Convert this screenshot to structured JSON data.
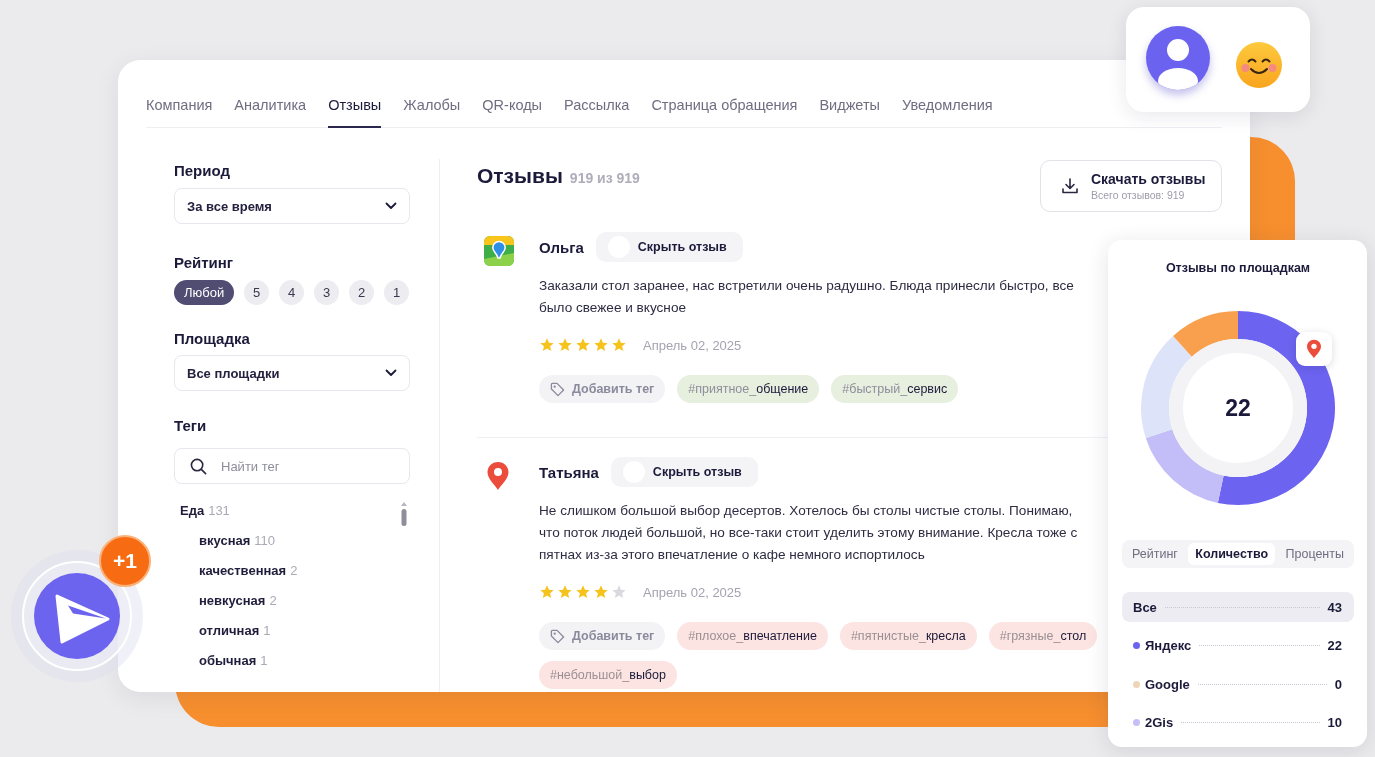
{
  "nav_tabs": [
    {
      "label": "Компания",
      "selected": false
    },
    {
      "label": "Аналитика",
      "selected": false
    },
    {
      "label": "Отзывы",
      "selected": true
    },
    {
      "label": "Жалобы",
      "selected": false
    },
    {
      "label": "QR-коды",
      "selected": false
    },
    {
      "label": "Рассылка",
      "selected": false
    },
    {
      "label": "Страница обращения",
      "selected": false
    },
    {
      "label": "Виджеты",
      "selected": false
    },
    {
      "label": "Уведомления",
      "selected": false
    }
  ],
  "filters": {
    "period": {
      "label": "Период",
      "value": "За все время"
    },
    "rating": {
      "label": "Рейтинг",
      "options": [
        {
          "label": "Любой",
          "selected": true
        },
        {
          "label": "5",
          "selected": false
        },
        {
          "label": "4",
          "selected": false
        },
        {
          "label": "3",
          "selected": false
        },
        {
          "label": "2",
          "selected": false
        },
        {
          "label": "1",
          "selected": false
        }
      ]
    },
    "platform": {
      "label": "Площадка",
      "value": "Все площадки"
    },
    "tags": {
      "label": "Теги",
      "search": {
        "placeholder": "Найти тег"
      },
      "tree": [
        {
          "label": "Еда",
          "count": "131",
          "children": [
            {
              "label": "вкусная",
              "count": "110"
            },
            {
              "label": "качественная",
              "count": "2"
            },
            {
              "label": "невкусная",
              "count": "2"
            },
            {
              "label": "отличная",
              "count": "1"
            },
            {
              "label": "обычная",
              "count": "1"
            }
          ]
        }
      ]
    }
  },
  "reviews_header": {
    "title": "Отзывы",
    "count": "919 из 919",
    "download": {
      "label": "Скачать отзывы",
      "sublabel": "Всего отзывов: 919"
    }
  },
  "reviews": [
    {
      "kind": "map",
      "author": "Ольга",
      "hide_toggle": {
        "label": "Скрыть отзыв",
        "on": false
      },
      "text": "Заказали стол заранее, нас встретили очень радушно. Блюда принесли быстро, все было свежее и вкусное",
      "stars": 5,
      "date": "Апрель 02, 2025",
      "add_tag": "Добавить тег",
      "tags": [
        {
          "text": "#приятное_**общение**",
          "kind": "positive"
        },
        {
          "text": "#быстрый_**сервис**",
          "kind": "positive"
        }
      ]
    },
    {
      "kind": "pin",
      "author": "Татьяна",
      "hide_toggle": {
        "label": "Скрыть отзыв",
        "on": false
      },
      "text": "Не слишком большой выбор десертов. Хотелось бы столы чистые столы. Понимаю, что поток людей большой, но все-таки стоит уделить этому внимание. Кресла тоже с пятнах из-за этого впечатление о кафе немного испортилось",
      "stars": 4,
      "date": "Апрель 02, 2025",
      "add_tag": "Добавить тег",
      "tags": [
        {
          "text": "#плохое_**впечатление**",
          "kind": "negative"
        },
        {
          "text": "#пятнистые_**кресла**",
          "kind": "negative"
        },
        {
          "text": "#грязные_**стол**",
          "kind": "negative"
        },
        {
          "text": "#небольшой_**выбор**",
          "kind": "negative"
        }
      ]
    }
  ],
  "platform_stats": {
    "title": "Отзывы по площадкам",
    "center_value": "22",
    "modes": [
      {
        "label": "Рейтинг",
        "selected": false
      },
      {
        "label": "Количество",
        "selected": true
      },
      {
        "label": "Проценты",
        "selected": false
      }
    ],
    "rows": [
      {
        "label": "Все",
        "value": "43",
        "selected": true
      },
      {
        "label": "Яндекс",
        "value": "22",
        "color": "#6c63f0",
        "selected": false
      },
      {
        "label": "Google",
        "value": "0",
        "color": "#efd5b8",
        "selected": false
      },
      {
        "label": "2Gis",
        "value": "10",
        "color": "#c4bff7",
        "selected": false
      }
    ]
  },
  "notification_badge": "+1"
}
